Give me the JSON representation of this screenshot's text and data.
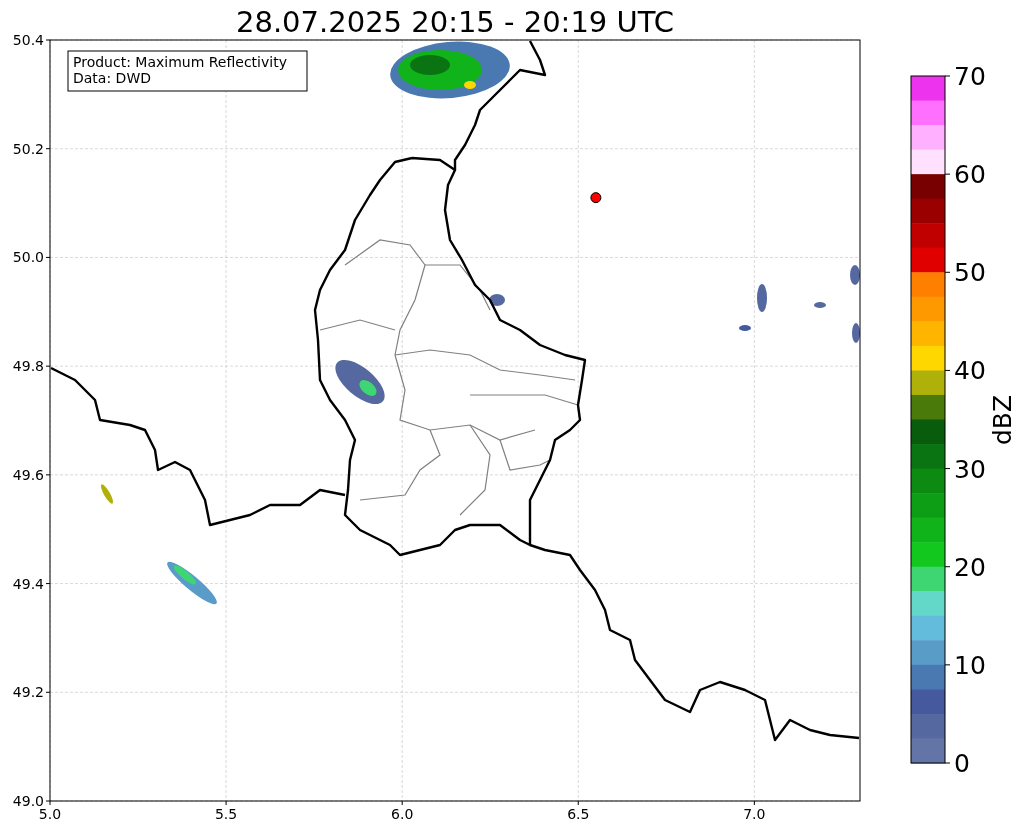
{
  "title": "28.07.2025 20:15 - 20:19 UTC",
  "info_box": {
    "lines": [
      "Product: Maximum Reflectivity",
      "Data: DWD"
    ]
  },
  "map": {
    "chart_data": {
      "type": "scatter",
      "xlim": [
        5.0,
        7.3
      ],
      "ylim": [
        49.0,
        50.4
      ],
      "xticks": [
        {
          "value": 5.0,
          "label": "5.0"
        },
        {
          "value": 5.5,
          "label": "5.5"
        },
        {
          "value": 6.0,
          "label": "6.0"
        },
        {
          "value": 6.5,
          "label": "6.5"
        },
        {
          "value": 7.0,
          "label": "7.0"
        }
      ],
      "yticks": [
        {
          "value": 49.0,
          "label": "49.0"
        },
        {
          "value": 49.2,
          "label": "49.2"
        },
        {
          "value": 49.4,
          "label": "49.4"
        },
        {
          "value": 49.6,
          "label": "49.6"
        },
        {
          "value": 49.8,
          "label": "49.8"
        },
        {
          "value": 50.0,
          "label": "50.0"
        },
        {
          "value": 50.2,
          "label": "50.2"
        },
        {
          "value": 50.4,
          "label": "50.4"
        }
      ],
      "grid": true,
      "x": [
        6.55
      ],
      "series": [
        {
          "color": "#ff0000",
          "values": [
            50.11
          ]
        }
      ]
    }
  },
  "colorbar": {
    "label": "dBZ",
    "ticks": [
      "70",
      "60",
      "50",
      "40",
      "30",
      "20",
      "10",
      "0"
    ],
    "bins": [
      {
        "color": "#ee33ee"
      },
      {
        "color": "#ff70ff"
      },
      {
        "color": "#ffb0ff"
      },
      {
        "color": "#ffe0ff"
      },
      {
        "color": "#780000"
      },
      {
        "color": "#9a0000"
      },
      {
        "color": "#c00000"
      },
      {
        "color": "#e00000"
      },
      {
        "color": "#ff7f00"
      },
      {
        "color": "#ff9900"
      },
      {
        "color": "#ffb400"
      },
      {
        "color": "#ffd700"
      },
      {
        "color": "#b0b00a"
      },
      {
        "color": "#4a7a0a"
      },
      {
        "color": "#085c0c"
      },
      {
        "color": "#0a7412"
      },
      {
        "color": "#0c8a12"
      },
      {
        "color": "#0e9e16"
      },
      {
        "color": "#10b41a"
      },
      {
        "color": "#12c81e"
      },
      {
        "color": "#3ed672"
      },
      {
        "color": "#64d8c8"
      },
      {
        "color": "#64bcdc"
      },
      {
        "color": "#5a9cc8"
      },
      {
        "color": "#4a78b0"
      },
      {
        "color": "#44599e"
      },
      {
        "color": "#5568a0"
      },
      {
        "color": "#6374a6"
      }
    ]
  }
}
